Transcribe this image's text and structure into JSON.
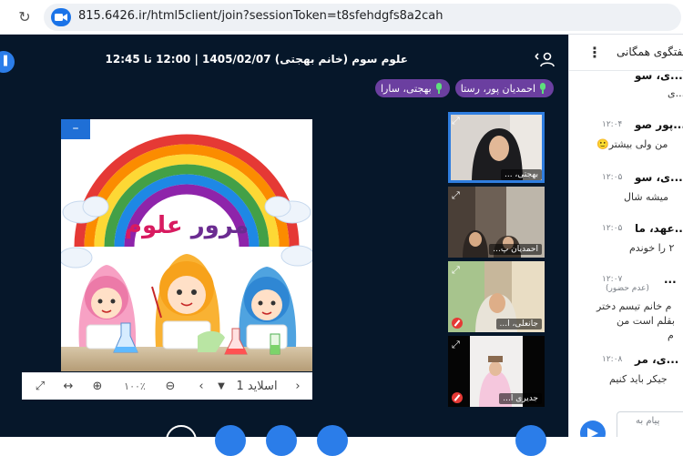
{
  "browser": {
    "url": "815.6426.ir/html5client/join?sessionToken=t8sfehdgfs8a2cah"
  },
  "meeting": {
    "title": "علوم سوم (خانم بهجتی) 1405/02/07 | 12:00 تا 12:45"
  },
  "presenters": [
    {
      "name": "بهجتی، سارا"
    },
    {
      "name": "احمدیان پور، رستا"
    }
  ],
  "slide": {
    "title_word1": "مرور",
    "title_word2": "علوم",
    "label": "اسلاید 1",
    "zoom": "۱۰۰٪"
  },
  "video_tiles": [
    {
      "name": "بهجتی، ..."
    },
    {
      "name": "احمدیان پ..."
    },
    {
      "name": "جانعلی، ا..."
    },
    {
      "name": "جدیری ا..."
    }
  ],
  "chat": {
    "title": "گفتگوی همگانی",
    "messages": [
      {
        "who": "...ی، سو",
        "time": "",
        "body": "...ی",
        "absent": ""
      },
      {
        "who": "...پور صو",
        "time": "۱۲:۰۴",
        "body": "من ولی بیشتر🙂",
        "absent": ""
      },
      {
        "who": "...ی، سو",
        "time": "۱۲:۰۵",
        "body": "میشه شال",
        "absent": ""
      },
      {
        "who": "...عهد، ما",
        "time": "۱۲:۰۵",
        "body": "۲ را خوندم",
        "absent": ""
      },
      {
        "who": "...",
        "time": "۱۲:۰۷",
        "body": "م خانم تیسم دختر",
        "body2": "بقلم است من",
        "body3": "م",
        "absent": "(عدم حضور)"
      },
      {
        "who": "...ی، مر",
        "time": "۱۲:۰۸",
        "body": "جیکر باید کنیم",
        "absent": ""
      }
    ],
    "composer_placeholder": "پیام به"
  }
}
